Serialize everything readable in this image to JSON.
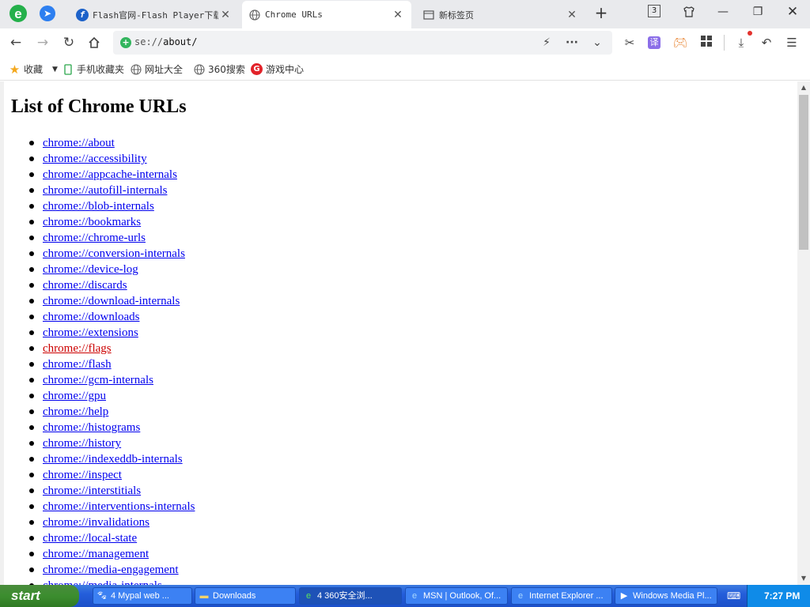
{
  "tabs": [
    {
      "title": "Flash官网-Flash Player下载",
      "icon": "flash-icon"
    },
    {
      "title": "Chrome URLs",
      "icon": "globe-icon"
    },
    {
      "title": "新标签页",
      "icon": "newtab-icon"
    }
  ],
  "tab_count": "3",
  "address": {
    "prefix": "se://",
    "path": "about/"
  },
  "bookmarks": [
    {
      "label": "收藏",
      "icon": "star-icon"
    },
    {
      "label": "手机收藏夹",
      "icon": "phone-icon"
    },
    {
      "label": "网址大全",
      "icon": "globe-icon"
    },
    {
      "label": "360搜索",
      "icon": "globe-icon"
    },
    {
      "label": "游戏中心",
      "icon": "game-icon"
    }
  ],
  "page": {
    "heading": "List of Chrome URLs",
    "links": [
      "chrome://about",
      "chrome://accessibility",
      "chrome://appcache-internals",
      "chrome://autofill-internals",
      "chrome://blob-internals",
      "chrome://bookmarks",
      "chrome://chrome-urls",
      "chrome://conversion-internals",
      "chrome://device-log",
      "chrome://discards",
      "chrome://download-internals",
      "chrome://downloads",
      "chrome://extensions",
      "chrome://flags",
      "chrome://flash",
      "chrome://gcm-internals",
      "chrome://gpu",
      "chrome://help",
      "chrome://histograms",
      "chrome://history",
      "chrome://indexeddb-internals",
      "chrome://inspect",
      "chrome://interstitials",
      "chrome://interventions-internals",
      "chrome://invalidations",
      "chrome://local-state",
      "chrome://management",
      "chrome://media-engagement",
      "chrome://media-internals"
    ],
    "highlighted_link": "chrome://flags"
  },
  "taskbar": {
    "start": "start",
    "tasks": [
      {
        "label": "4 Mypal web ...",
        "icon": "mypal-icon"
      },
      {
        "label": "Downloads",
        "icon": "folder-icon"
      },
      {
        "label": "4 360安全浏...",
        "icon": "browser-360-icon"
      },
      {
        "label": "MSN | Outlook, Of...",
        "icon": "ie-icon"
      },
      {
        "label": "Internet Explorer ...",
        "icon": "ie-icon"
      },
      {
        "label": "Windows Media Pl...",
        "icon": "media-player-icon"
      }
    ],
    "clock": "7:27 PM"
  },
  "colors": {
    "link": "#0000ee",
    "link_active": "#cc0000",
    "taskbar": "#245edb",
    "start_button": "#3c8d2f"
  }
}
